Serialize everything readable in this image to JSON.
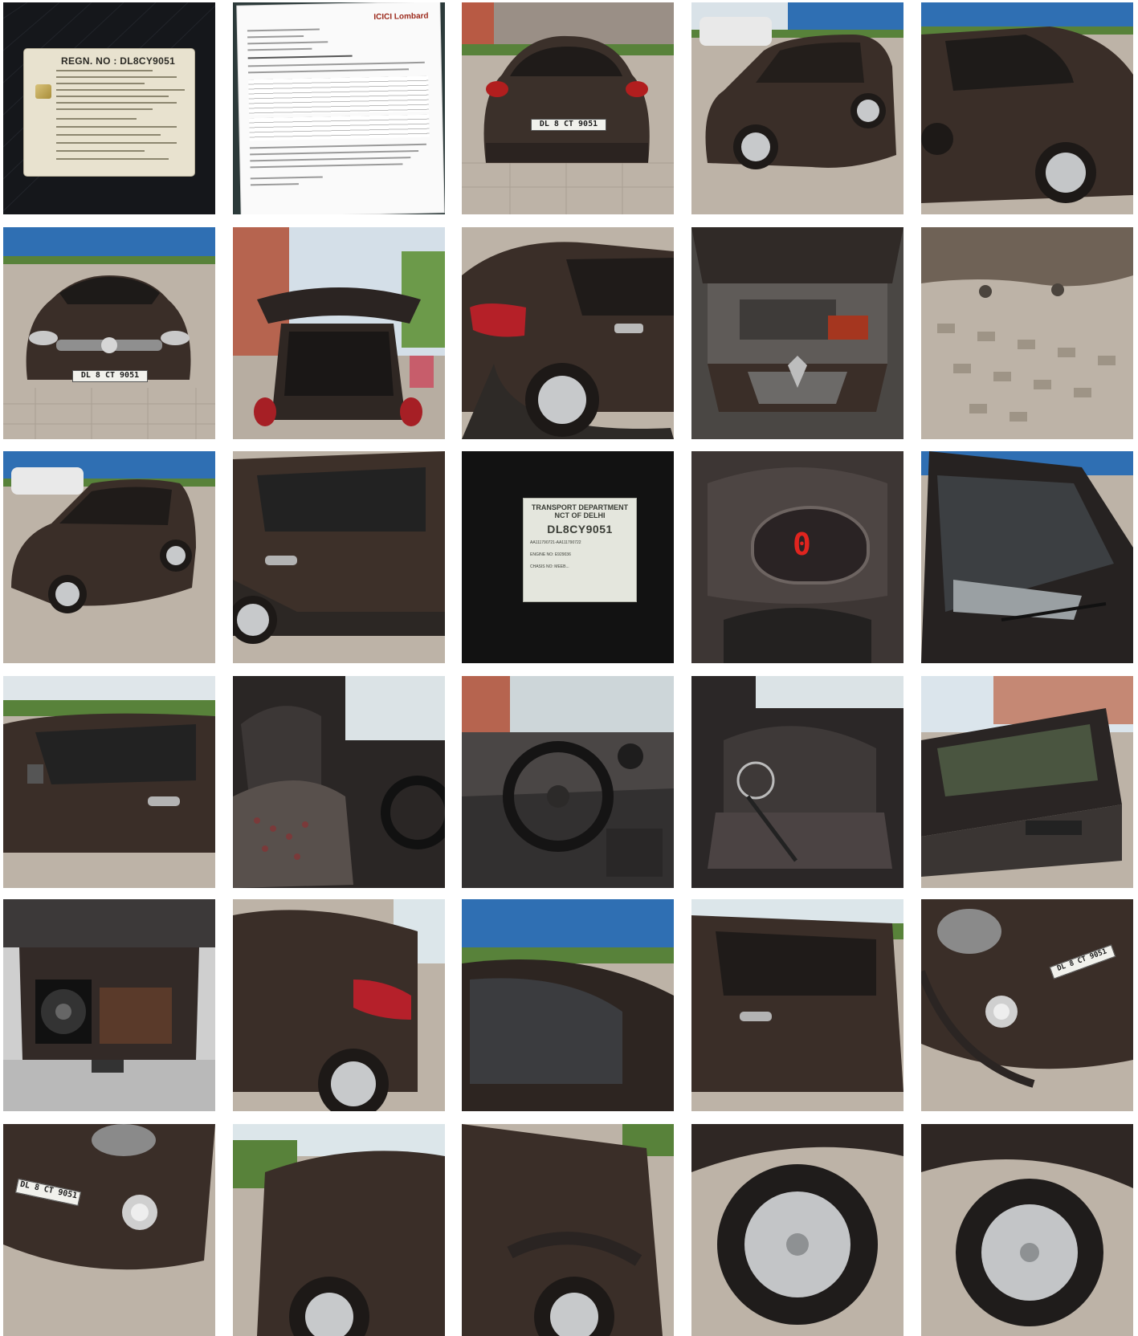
{
  "gallery": {
    "columns": 5,
    "rows": 6,
    "tile_count": 30
  },
  "registration_card": {
    "title": "REGN. NO : DL8CY9051"
  },
  "insurance": {
    "brand": "ICICI Lombard"
  },
  "transport_sticker": {
    "line1": "TRANSPORT DEPARTMENT",
    "line2": "NCT OF DELHI",
    "reg_no": "DL8CY9051",
    "field1": "AA111790721-AA111790722",
    "field2": "ENGINE NO: E929036",
    "field3": "CHASIS NO: MEEB..."
  },
  "dashboard": {
    "speed_reading": "0"
  },
  "number_plate": {
    "text": "DL 8 CT 9051"
  },
  "colors": {
    "car_body": "#3a2e28",
    "pavement": "#bcb2a6",
    "fence_blue": "#2f6fb3",
    "hedge": "#4d7a32",
    "sky": "#e8eef3",
    "background": "#ffffff"
  },
  "tiles": [
    {
      "kind": "document",
      "subject": "registration-card"
    },
    {
      "kind": "document",
      "subject": "insurance-policy"
    },
    {
      "kind": "photo",
      "subject": "car-rear-view"
    },
    {
      "kind": "photo",
      "subject": "car-front-quarter"
    },
    {
      "kind": "photo",
      "subject": "car-side-quarter"
    },
    {
      "kind": "photo",
      "subject": "car-front-view"
    },
    {
      "kind": "photo",
      "subject": "open-tailgate"
    },
    {
      "kind": "photo",
      "subject": "rear-quarter"
    },
    {
      "kind": "photo",
      "subject": "engine-bay"
    },
    {
      "kind": "photo",
      "subject": "underbody"
    },
    {
      "kind": "photo",
      "subject": "car-front-quarter-2"
    },
    {
      "kind": "photo",
      "subject": "rear-door-side"
    },
    {
      "kind": "photo",
      "subject": "windshield-sticker"
    },
    {
      "kind": "photo",
      "subject": "instrument-cluster"
    },
    {
      "kind": "photo",
      "subject": "windshield"
    },
    {
      "kind": "photo",
      "subject": "front-door-side"
    },
    {
      "kind": "photo",
      "subject": "front-seats"
    },
    {
      "kind": "photo",
      "subject": "steering-dashboard"
    },
    {
      "kind": "photo",
      "subject": "rear-seats"
    },
    {
      "kind": "photo",
      "subject": "open-door-panel"
    },
    {
      "kind": "photo",
      "subject": "boot-subwoofer"
    },
    {
      "kind": "photo",
      "subject": "rear-panel-taillight"
    },
    {
      "kind": "photo",
      "subject": "roof-reflection"
    },
    {
      "kind": "photo",
      "subject": "side-windows"
    },
    {
      "kind": "photo",
      "subject": "front-bumper-plate"
    },
    {
      "kind": "photo",
      "subject": "front-bumper-foglamp"
    },
    {
      "kind": "photo",
      "subject": "front-fender"
    },
    {
      "kind": "photo",
      "subject": "rear-fender"
    },
    {
      "kind": "photo",
      "subject": "front-wheel"
    },
    {
      "kind": "photo",
      "subject": "rear-wheel"
    }
  ]
}
